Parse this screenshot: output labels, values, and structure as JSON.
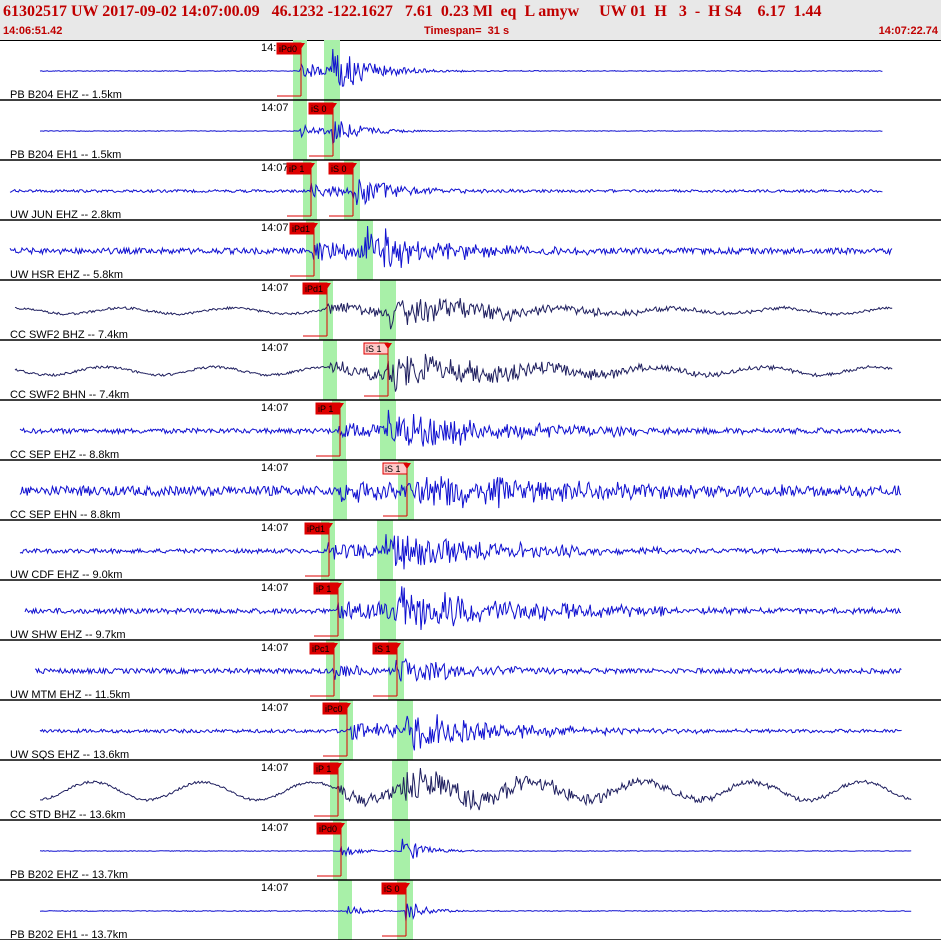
{
  "header": {
    "title": "61302517 UW 2017-09-02 14:07:00.09   46.1232 -122.1627   7.61  0.23 Ml  eq  L amyw     UW 01  H   3  -  H S4    6.17  1.44",
    "start_time": "14:06:51.42",
    "timespan": "Timespan=  31 s",
    "end_time": "14:07:22.74"
  },
  "colors": {
    "trace_blue": "#1010d0",
    "trace_dark": "#202060",
    "pick_red": "#dd0000",
    "pick_pink": "#ffc8c8",
    "window_green": "#a8f0a8",
    "header_bg": "#e8e8e8",
    "header_text": "#c00000"
  },
  "channels": [
    {
      "time_label": "14:07",
      "label": "PB B204 EHZ -- 1.5km",
      "color": "blue",
      "noise": 0.4,
      "burst": 22,
      "decay": 38,
      "end": 0.96
    },
    {
      "time_label": "14:07",
      "label": "PB B204 EH1 -- 1.5km",
      "color": "blue",
      "noise": 0.3,
      "burst": 14,
      "decay": 30,
      "end": 0.96
    },
    {
      "time_label": "14:07",
      "label": "UW JUN EHZ -- 2.8km",
      "color": "blue",
      "noise": 1.4,
      "burst": 18,
      "decay": 40,
      "end": 0.96
    },
    {
      "time_label": "14:07",
      "label": "UW HSR EHZ -- 5.8km",
      "color": "blue",
      "noise": 3,
      "burst": 22,
      "decay": 80,
      "end": 0.97
    },
    {
      "time_label": "14:07",
      "label": "CC SWF2 BHZ -- 7.4km",
      "color": "dark",
      "noise": 1.2,
      "burst": 14,
      "decay": 140,
      "end": 0.97,
      "wave": 3
    },
    {
      "time_label": "14:07",
      "label": "CC SWF2 BHN -- 7.4km",
      "color": "dark",
      "noise": 1.2,
      "burst": 16,
      "decay": 160,
      "end": 0.97,
      "wave": 4
    },
    {
      "time_label": "14:07",
      "label": "CC SEP EHZ -- 8.8km",
      "color": "blue",
      "noise": 2.5,
      "burst": 18,
      "decay": 130,
      "end": 0.98
    },
    {
      "time_label": "14:07",
      "label": "CC SEP EHN -- 8.8km",
      "color": "blue",
      "noise": 5,
      "burst": 18,
      "decay": 170,
      "end": 0.98
    },
    {
      "time_label": "14:07",
      "label": "UW CDF EHZ -- 9.0km",
      "color": "blue",
      "noise": 2.2,
      "burst": 20,
      "decay": 110,
      "end": 0.98
    },
    {
      "time_label": "14:07",
      "label": "UW SHW EHZ -- 9.7km",
      "color": "blue",
      "noise": 2.6,
      "burst": 22,
      "decay": 140,
      "end": 0.98
    },
    {
      "time_label": "14:07",
      "label": "UW MTM EHZ -- 11.5km",
      "color": "blue",
      "noise": 2.5,
      "burst": 16,
      "decay": 60,
      "end": 0.98
    },
    {
      "time_label": "14:07",
      "label": "UW SQS EHZ -- 13.6km",
      "color": "blue",
      "noise": 1.8,
      "burst": 20,
      "decay": 90,
      "end": 0.98
    },
    {
      "time_label": "14:07",
      "label": "CC STD BHZ -- 13.6km",
      "color": "dark",
      "noise": 1.2,
      "burst": 16,
      "decay": 170,
      "end": 0.99,
      "wave": 9
    },
    {
      "time_label": "14:07",
      "label": "PB B202 EHZ -- 13.7km",
      "color": "blue",
      "noise": 0.3,
      "burst": 14,
      "decay": 22,
      "end": 0.99
    },
    {
      "time_label": "14:07",
      "label": "PB B202 EH1 -- 13.7km",
      "color": "blue",
      "noise": 0.4,
      "burst": 12,
      "decay": 20,
      "end": 0.99
    }
  ],
  "picks": [
    {
      "channel": 0,
      "label": "iPd0",
      "phase": "P",
      "style": "red"
    },
    {
      "channel": 1,
      "label": "iS 0",
      "phase": "S",
      "style": "red"
    },
    {
      "channel": 2,
      "label": "iP 1",
      "phase": "P",
      "style": "red"
    },
    {
      "channel": 2,
      "label": "iS 0",
      "phase": "S",
      "style": "red"
    },
    {
      "channel": 3,
      "label": "iPd1",
      "phase": "P",
      "style": "red"
    },
    {
      "channel": 4,
      "label": "iPd1",
      "phase": "P",
      "style": "red"
    },
    {
      "channel": 5,
      "label": "iS 1",
      "phase": "S",
      "style": "pink"
    },
    {
      "channel": 6,
      "label": "iP 1",
      "phase": "P",
      "style": "red"
    },
    {
      "channel": 7,
      "label": "iS 1",
      "phase": "S",
      "style": "pink"
    },
    {
      "channel": 8,
      "label": "iPd1",
      "phase": "P",
      "style": "red"
    },
    {
      "channel": 9,
      "label": "iP 1",
      "phase": "P",
      "style": "red"
    },
    {
      "channel": 10,
      "label": "iPc1",
      "phase": "P",
      "style": "red"
    },
    {
      "channel": 10,
      "label": "iS 1",
      "phase": "S",
      "style": "red"
    },
    {
      "channel": 11,
      "label": "iPc0",
      "phase": "P",
      "style": "red"
    },
    {
      "channel": 12,
      "label": "iP 1",
      "phase": "P",
      "style": "red"
    },
    {
      "channel": 13,
      "label": "iPd0",
      "phase": "P",
      "style": "red"
    },
    {
      "channel": 14,
      "label": "iS 0",
      "phase": "S",
      "style": "red"
    }
  ]
}
